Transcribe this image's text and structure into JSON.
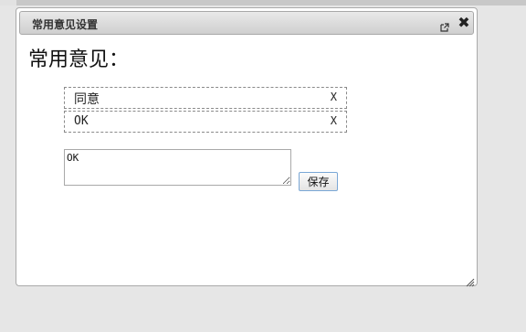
{
  "dialog": {
    "title": "常用意见设置",
    "icons": {
      "popout": "popout-icon",
      "close": "close-icon",
      "close_glyph": "✖",
      "resize": "resize-grip-icon"
    }
  },
  "heading": "常用意见：",
  "opinions": [
    {
      "text": "同意",
      "delete_label": "X"
    },
    {
      "text": "OK",
      "delete_label": "X"
    }
  ],
  "input": {
    "value": "OK",
    "placeholder": ""
  },
  "save_button": "保存",
  "colors": {
    "background": "#e6e6e6",
    "dialog": "#ffffff",
    "save_border": "#7aa7d6"
  }
}
